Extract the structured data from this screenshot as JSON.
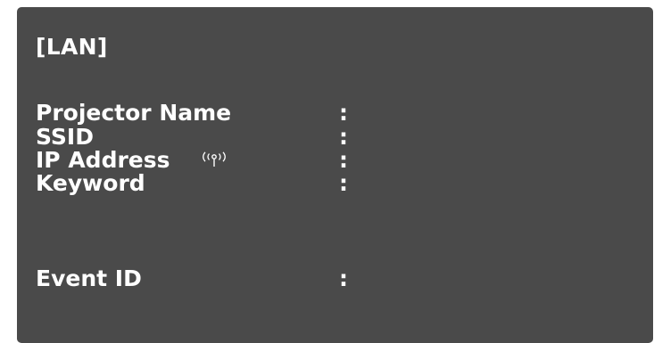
{
  "header": {
    "title": "[LAN]"
  },
  "info_rows": [
    {
      "label": "Projector Name",
      "separator": ":",
      "value": ""
    },
    {
      "label": "SSID",
      "separator": ":",
      "value": ""
    },
    {
      "label": "IP Address",
      "separator": ":",
      "value": "",
      "icon": "wireless-signal-icon"
    },
    {
      "label": "Keyword",
      "separator": ":",
      "value": ""
    },
    {
      "label": "Event ID",
      "separator": ":",
      "value": ""
    }
  ],
  "colors": {
    "panel_background": "#4a4a4a",
    "text": "#ffffff"
  }
}
